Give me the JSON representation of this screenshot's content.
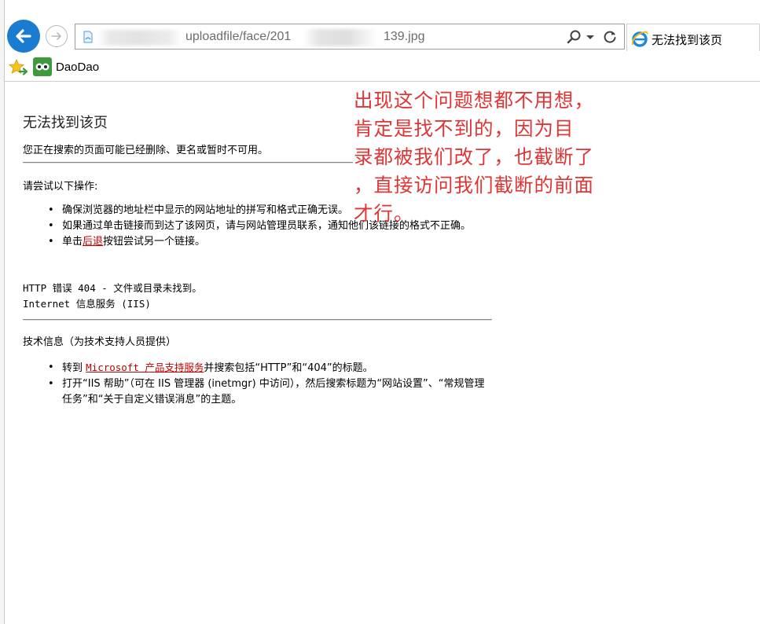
{
  "browser": {
    "url_visible_start": "uploadfile/face/201",
    "url_visible_end": "139.jpg",
    "tab_title": "无法找到该页",
    "favorites": [
      {
        "label": "DaoDao"
      }
    ],
    "accent_color": "#1a7cd0"
  },
  "page": {
    "title": "无法找到该页",
    "subtitle": "您正在搜索的页面可能已经删除、更名或暂时不可用。",
    "try_heading": "请尝试以下操作:",
    "suggestions": [
      {
        "text": "确保浏览器的地址栏中显示的网站地址的拼写和格式正确无误。"
      },
      {
        "text": "如果通过单击链接而到达了该网页，请与网站管理员联系，通知他们该链接的格式不正确。"
      },
      {
        "prefix": "单击",
        "link": "后退",
        "suffix": "按钮尝试另一个链接。"
      }
    ],
    "error_line": "HTTP 错误 404 - 文件或目录未找到。",
    "server_line": "Internet 信息服务 (IIS)",
    "tech_heading": "技术信息（为技术支持人员提供）",
    "tech_items": [
      {
        "prefix": "转到 ",
        "link": "Microsoft 产品支持服务",
        "suffix": "并搜索包括“HTTP”和“404”的标题。"
      },
      {
        "text": "打开“IIS 帮助”（可在 IIS 管理器 (inetmgr) 中访问），然后搜索标题为“网站设置”、“常规管理任务”和“关于自定义错误消息”的主题。"
      }
    ]
  },
  "annotation": {
    "lines": [
      "出现这个问题想都不用想，",
      "肯定是找不到的，因为目",
      "录都被我们改了，也截断了",
      "，直接访问我们截断的前面",
      "才行。"
    ],
    "color": "#e03535"
  }
}
